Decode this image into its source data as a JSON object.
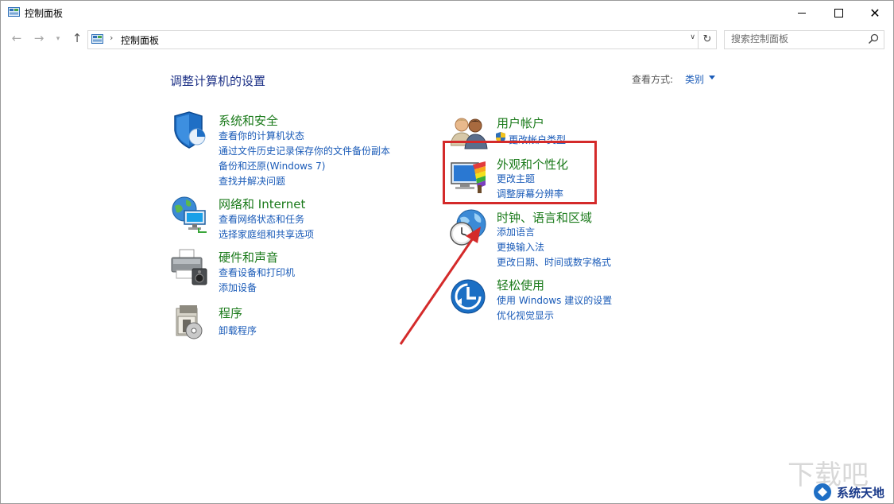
{
  "window": {
    "title": "控制面板",
    "controls": {
      "minimize": "minimize",
      "maximize": "maximize",
      "close": "close"
    }
  },
  "address_bar": {
    "path": "控制面板",
    "search_placeholder": "搜索控制面板"
  },
  "main": {
    "heading": "调整计算机的设置",
    "view_by_label": "查看方式:",
    "view_by_value": "类别",
    "left_categories": [
      {
        "title": "系统和安全",
        "icon": "shield-icon",
        "links": [
          "查看你的计算机状态",
          "通过文件历史记录保存你的文件备份副本",
          "备份和还原(Windows 7)",
          "查找并解决问题"
        ]
      },
      {
        "title": "网络和 Internet",
        "icon": "network-globe-icon",
        "links": [
          "查看网络状态和任务",
          "选择家庭组和共享选项"
        ]
      },
      {
        "title": "硬件和声音",
        "icon": "printer-icon",
        "links": [
          "查看设备和打印机",
          "添加设备"
        ]
      },
      {
        "title": "程序",
        "icon": "programs-icon",
        "links": [
          "卸载程序"
        ]
      }
    ],
    "right_categories": [
      {
        "title": "用户帐户",
        "icon": "users-icon",
        "links": [
          "更改帐户类型"
        ]
      },
      {
        "title": "外观和个性化",
        "icon": "appearance-icon",
        "links": [
          "更改主题",
          "调整屏幕分辨率"
        ]
      },
      {
        "title": "时钟、语言和区域",
        "icon": "clock-globe-icon",
        "links": [
          "添加语言",
          "更换输入法",
          "更改日期、时间或数字格式"
        ]
      },
      {
        "title": "轻松使用",
        "icon": "ease-of-access-icon",
        "links": [
          "使用 Windows 建议的设置",
          "优化视觉显示"
        ]
      }
    ]
  },
  "annotations": {
    "highlight_color": "#d42a2a"
  },
  "watermark": {
    "brand": "系统天地"
  }
}
